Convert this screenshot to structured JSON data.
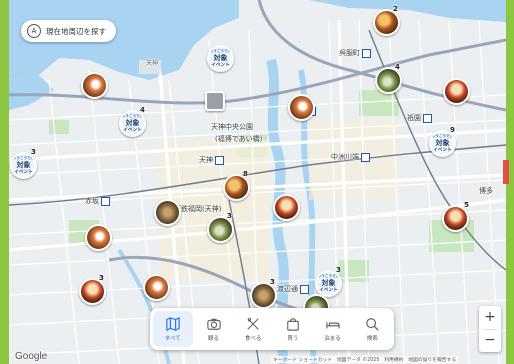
{
  "search_area_button": {
    "label": "現在地周辺を探す",
    "icon": "search-area-icon"
  },
  "place_labels": {
    "tenjin": "天神",
    "tenjin_central_park": "天神中央公園",
    "fukuhaku": "(福博であい橋)",
    "nakasu_kawabata": "中洲川端",
    "gofukumachi": "呉服町",
    "gion": "祇園",
    "nakasu": "中洲",
    "hakata": "博多",
    "akasaka": "赤坂",
    "nishitetsu_fukuoka": "西鉄福岡(天神)",
    "watanabe_dori": "渡辺通",
    "tenjin_road": "天神"
  },
  "markers": [
    {
      "type": "photo",
      "count": "2"
    },
    {
      "type": "photo",
      "count": ""
    },
    {
      "type": "event",
      "count": "",
      "top": "ゆうこうでん",
      "mid": "対象",
      "bot": "イベント"
    },
    {
      "type": "location",
      "count": ""
    },
    {
      "type": "event",
      "count": "4",
      "top": "ゆうこうでん",
      "mid": "対象",
      "bot": "イベント"
    },
    {
      "type": "photo",
      "count": "4"
    },
    {
      "type": "photo",
      "count": ""
    },
    {
      "type": "photo",
      "count": ""
    },
    {
      "type": "event",
      "count": "9",
      "top": "ゆうこうでん",
      "mid": "対象",
      "bot": "イベント"
    },
    {
      "type": "event",
      "count": "3",
      "top": "ゆうこうでん",
      "mid": "対象",
      "bot": "イベント"
    },
    {
      "type": "photo",
      "count": "8"
    },
    {
      "type": "photo",
      "count": ""
    },
    {
      "type": "photo",
      "count": ""
    },
    {
      "type": "photo",
      "count": "3"
    },
    {
      "type": "photo",
      "count": "5"
    },
    {
      "type": "photo",
      "count": ""
    },
    {
      "type": "photo",
      "count": "3"
    },
    {
      "type": "photo",
      "count": ""
    },
    {
      "type": "photo",
      "count": "3"
    },
    {
      "type": "event",
      "count": "3",
      "top": "ゆうこうでん",
      "mid": "対象",
      "bot": "イベント"
    },
    {
      "type": "photo",
      "count": ""
    }
  ],
  "toolbar": {
    "items": [
      {
        "label": "すべて",
        "icon": "map-icon",
        "active": true
      },
      {
        "label": "観る",
        "icon": "camera-icon",
        "active": false
      },
      {
        "label": "食べる",
        "icon": "fork-knife-icon",
        "active": false
      },
      {
        "label": "買う",
        "icon": "shopping-bag-icon",
        "active": false
      },
      {
        "label": "泊まる",
        "icon": "bed-icon",
        "active": false
      },
      {
        "label": "検索",
        "icon": "search-icon",
        "active": false
      }
    ]
  },
  "zoom": {
    "in_label": "+",
    "out_label": "−"
  },
  "google_logo": "Google",
  "attribution": "キーボード ショートカット　地図データ ©2025　利用規約　地図の誤りを報告する",
  "colors": {
    "frame_border": "#8dc63f",
    "water": "#a8d4f2",
    "land": "#eceff1",
    "park": "#c9e6c1",
    "road_major": "#ffffff",
    "expressway": "#9aa6b8",
    "rail": "#6e7b8b",
    "active_accent": "#1a73e8"
  }
}
